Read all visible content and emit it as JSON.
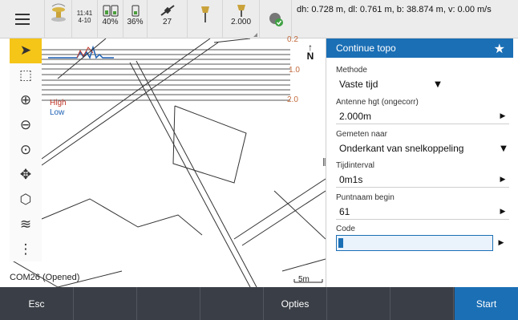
{
  "statusbar": {
    "time": "11:41",
    "date": "4-10",
    "battery1": "40%",
    "battery2": "36%",
    "satellites": "27",
    "antenna_height": "2.000",
    "position_info": "dh: 0.728 m, dl: 0.761 m, b: 38.874 m, v: 0.00 m/s"
  },
  "map": {
    "scale_top": "0.2",
    "scale_mid": "1.0",
    "scale_bottom": "2.0",
    "north": "N",
    "legend_high": "High",
    "legend_low": "Low",
    "com_status": "COM26 (Opened)",
    "scalebar": "5m"
  },
  "panel": {
    "title": "Continue topo",
    "fields": [
      {
        "label": "Methode",
        "value": "Vaste tijd"
      },
      {
        "label": "Antenne hgt (ongecorr)",
        "value": "2.000m"
      },
      {
        "label": "Gemeten naar",
        "value": "Onderkant van snelkoppeling"
      },
      {
        "label": "Tijdinterval",
        "value": "0m1s"
      },
      {
        "label": "Puntnaam begin",
        "value": "61"
      },
      {
        "label": "Code",
        "value": ""
      }
    ]
  },
  "bottombar": {
    "esc": "Esc",
    "opties": "Opties",
    "start": "Start"
  },
  "colors": {
    "accent": "#1b6fb5",
    "toolbar_active": "#f5c518",
    "bottom_bar": "#3a3f47",
    "high": "#c0392b",
    "low": "#1b5fb3"
  }
}
